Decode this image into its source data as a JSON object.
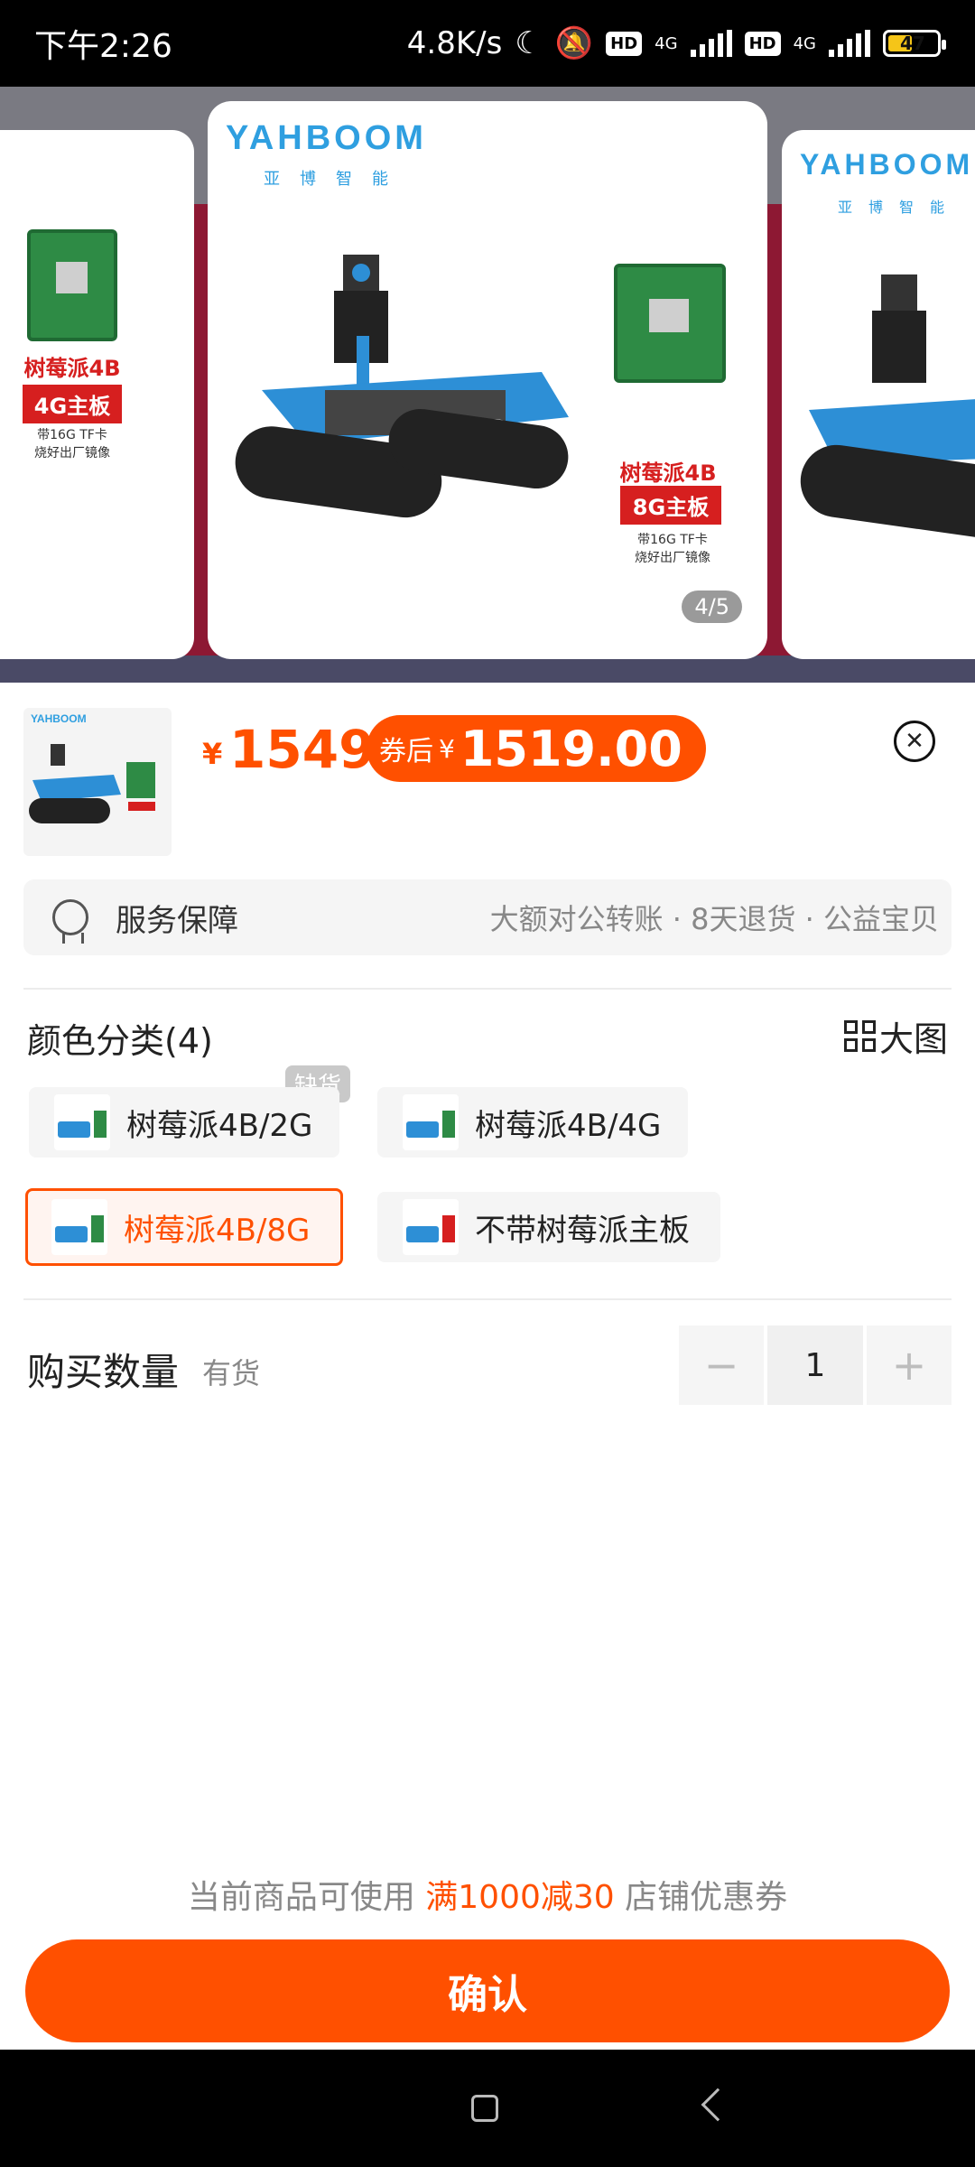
{
  "status_bar": {
    "time": "下午2:26",
    "speed": "4.8K/s",
    "hd_label": "HD",
    "network": "4G",
    "battery": "47"
  },
  "gallery": {
    "brand": "YAHBOOM",
    "brand_cn": "亚博智能",
    "page_indicator": "4/5",
    "left_card": {
      "title": "树莓派4B",
      "tag": "4G主板",
      "note_line1": "带16G TF卡",
      "note_line2": "烧好出厂镜像"
    },
    "main_card": {
      "title": "树莓派4B",
      "tag": "8G主板",
      "note_line1": "带16G TF卡",
      "note_line2": "烧好出厂镜像"
    }
  },
  "product": {
    "currency": "¥",
    "price": "1549",
    "coupon_label": "券后",
    "coupon_currency": "¥",
    "coupon_price": "1519.00"
  },
  "service": {
    "title": "服务保障",
    "detail": "大额对公转账 · 8天退货 · 公益宝贝"
  },
  "color_section": {
    "title": "颜色分类(4)",
    "big_view": "大图",
    "out_of_stock": "缺货",
    "options": [
      {
        "label": "树莓派4B/2G",
        "selected": false,
        "out_of_stock": true
      },
      {
        "label": "树莓派4B/4G",
        "selected": false,
        "out_of_stock": false
      },
      {
        "label": "树莓派4B/8G",
        "selected": true,
        "out_of_stock": false
      },
      {
        "label": "不带树莓派主板",
        "selected": false,
        "out_of_stock": false
      }
    ]
  },
  "quantity": {
    "title": "购买数量",
    "stock": "有货",
    "minus": "−",
    "value": "1",
    "plus": "+"
  },
  "coupon_tip": {
    "prefix": "当前商品可使用",
    "highlight": "满1000减30",
    "suffix": "店铺优惠券"
  },
  "confirm_label": "确认",
  "colors": {
    "accent": "#ff5000",
    "promo_red": "#d61f1f",
    "brand_blue": "#2f9fe0"
  }
}
